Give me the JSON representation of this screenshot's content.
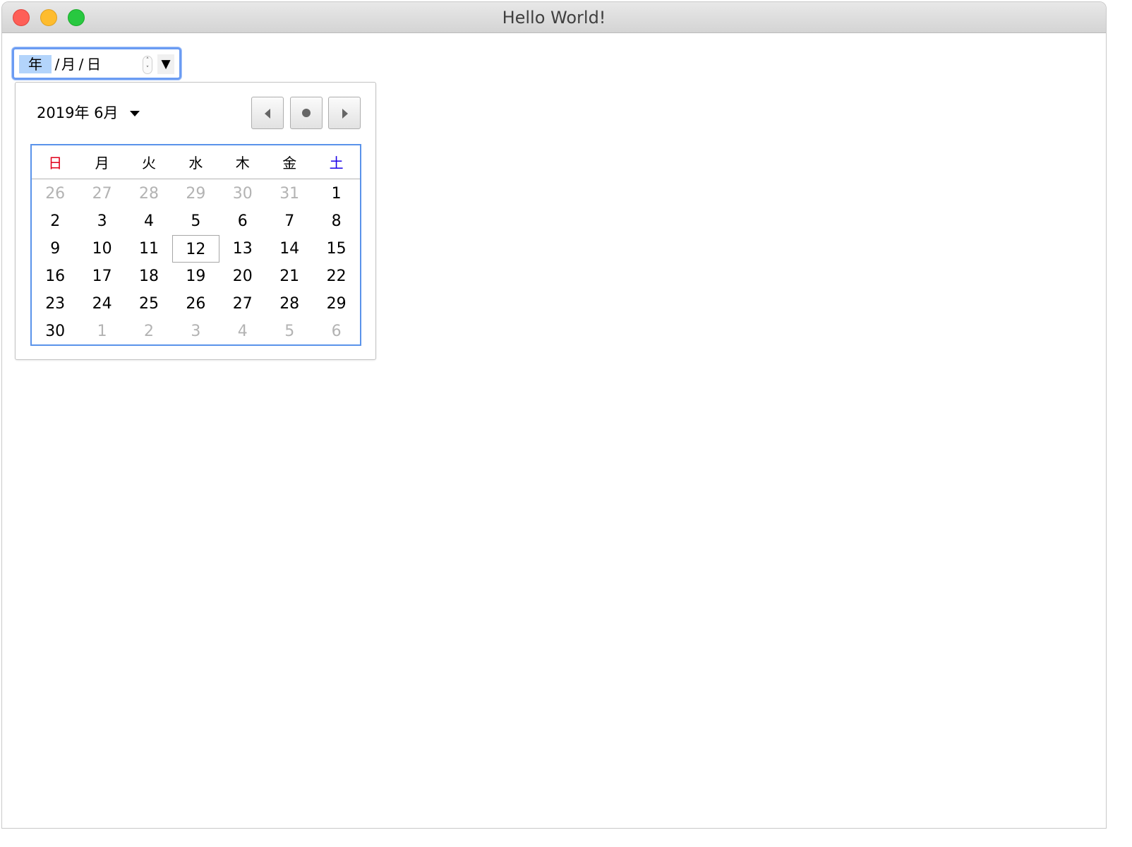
{
  "window": {
    "title": "Hello World!"
  },
  "date_input": {
    "year_placeholder": "年",
    "sep1": "/",
    "month_placeholder": "月",
    "sep2": "/",
    "day_placeholder": "日",
    "spin_up": "˄",
    "spin_down": "˅",
    "dropdown": "▼"
  },
  "calendar": {
    "month_label": "2019年 6月",
    "weekdays": [
      "日",
      "月",
      "火",
      "水",
      "木",
      "金",
      "土"
    ],
    "weekday_colors": {
      "sunday": "#e0001b",
      "saturday": "#1a00e8"
    },
    "weeks": [
      [
        {
          "d": "26",
          "muted": true
        },
        {
          "d": "27",
          "muted": true
        },
        {
          "d": "28",
          "muted": true
        },
        {
          "d": "29",
          "muted": true
        },
        {
          "d": "30",
          "muted": true
        },
        {
          "d": "31",
          "muted": true
        },
        {
          "d": "1",
          "muted": false
        }
      ],
      [
        {
          "d": "2",
          "muted": false
        },
        {
          "d": "3",
          "muted": false
        },
        {
          "d": "4",
          "muted": false
        },
        {
          "d": "5",
          "muted": false
        },
        {
          "d": "6",
          "muted": false
        },
        {
          "d": "7",
          "muted": false
        },
        {
          "d": "8",
          "muted": false
        }
      ],
      [
        {
          "d": "9",
          "muted": false
        },
        {
          "d": "10",
          "muted": false
        },
        {
          "d": "11",
          "muted": false
        },
        {
          "d": "12",
          "muted": false,
          "today": true
        },
        {
          "d": "13",
          "muted": false
        },
        {
          "d": "14",
          "muted": false
        },
        {
          "d": "15",
          "muted": false
        }
      ],
      [
        {
          "d": "16",
          "muted": false
        },
        {
          "d": "17",
          "muted": false
        },
        {
          "d": "18",
          "muted": false
        },
        {
          "d": "19",
          "muted": false
        },
        {
          "d": "20",
          "muted": false
        },
        {
          "d": "21",
          "muted": false
        },
        {
          "d": "22",
          "muted": false
        }
      ],
      [
        {
          "d": "23",
          "muted": false
        },
        {
          "d": "24",
          "muted": false
        },
        {
          "d": "25",
          "muted": false
        },
        {
          "d": "26",
          "muted": false
        },
        {
          "d": "27",
          "muted": false
        },
        {
          "d": "28",
          "muted": false
        },
        {
          "d": "29",
          "muted": false
        }
      ],
      [
        {
          "d": "30",
          "muted": false
        },
        {
          "d": "1",
          "muted": true
        },
        {
          "d": "2",
          "muted": true
        },
        {
          "d": "3",
          "muted": true
        },
        {
          "d": "4",
          "muted": true
        },
        {
          "d": "5",
          "muted": true
        },
        {
          "d": "6",
          "muted": true
        }
      ]
    ],
    "nav": {
      "prev_icon": "triangle-left-icon",
      "today_icon": "dot-icon",
      "next_icon": "triangle-right-icon"
    }
  }
}
